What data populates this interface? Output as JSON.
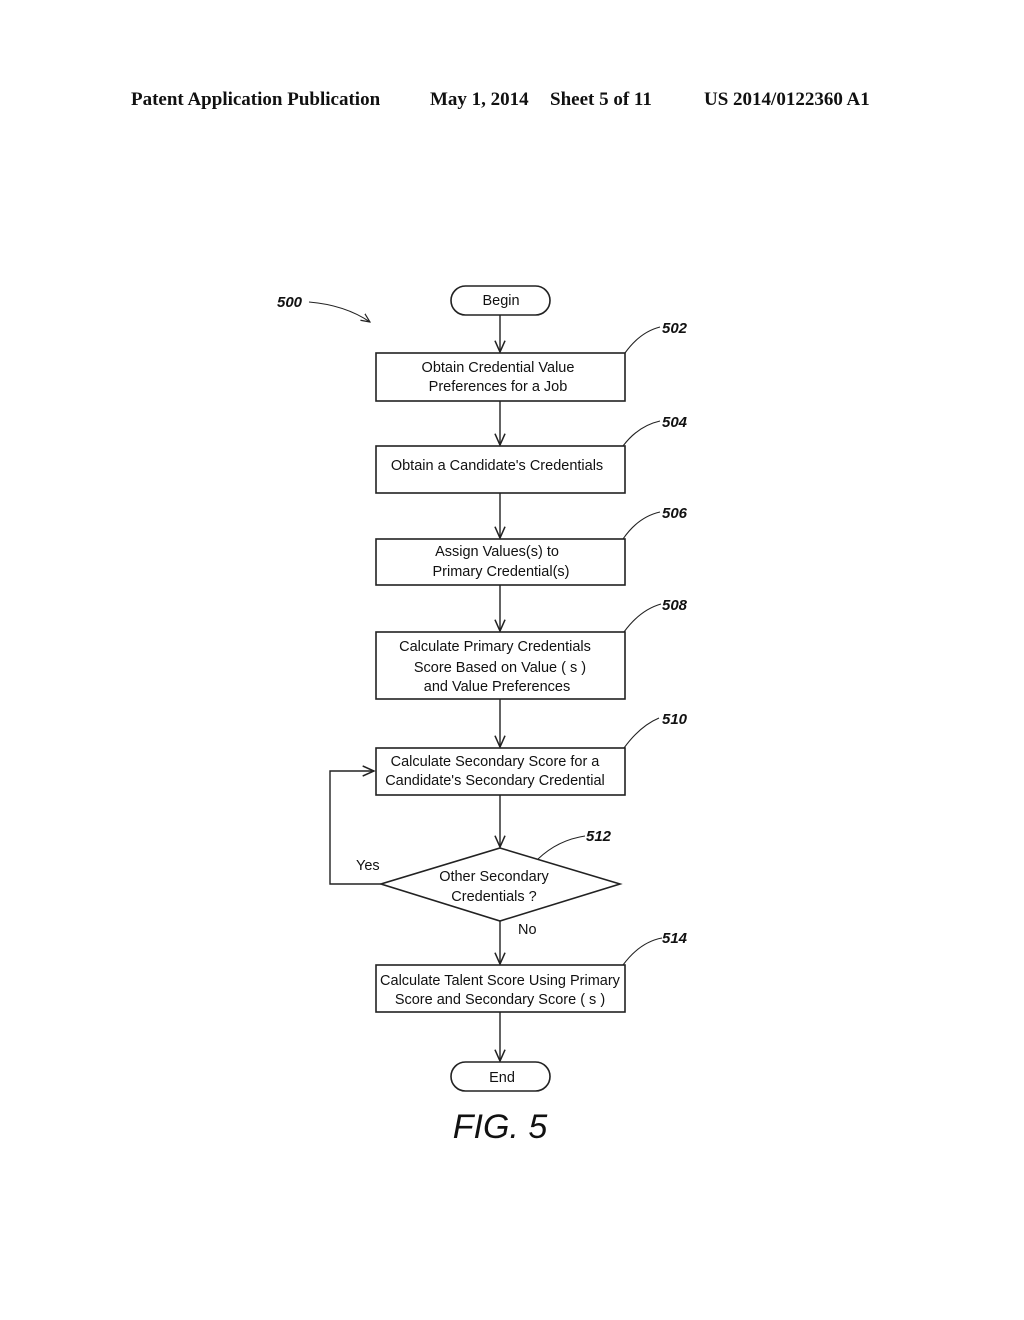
{
  "header": {
    "publication": "Patent Application Publication",
    "date": "May 1, 2014",
    "sheet": "Sheet 5 of 11",
    "number": "US 2014/0122360 A1"
  },
  "figure": {
    "label": "FIG. 5",
    "ref": "500"
  },
  "nodes": {
    "begin": {
      "type": "terminal",
      "lines": [
        "Begin"
      ]
    },
    "n502": {
      "type": "process",
      "ref": "502",
      "lines": [
        "Obtain Credential Value",
        "Preferences for a Job"
      ]
    },
    "n504": {
      "type": "process",
      "ref": "504",
      "lines": [
        "Obtain a Candidate's Credentials"
      ]
    },
    "n506": {
      "type": "process",
      "ref": "506",
      "lines": [
        "Assign Values(s)  to",
        "Primary Credential(s)"
      ]
    },
    "n508": {
      "type": "process",
      "ref": "508",
      "lines": [
        "Calculate Primary Credentials",
        "Score Based on Value ( s )",
        "and Value Preferences"
      ]
    },
    "n510": {
      "type": "process",
      "ref": "510",
      "lines": [
        "Calculate Secondary Score for a",
        "Candidate's Secondary Credential"
      ]
    },
    "n512": {
      "type": "decision",
      "ref": "512",
      "lines": [
        "Other Secondary",
        "Credentials ?"
      ]
    },
    "n514": {
      "type": "process",
      "ref": "514",
      "lines": [
        "Calculate Talent Score Using Primary",
        "Score and Secondary Score ( s )"
      ]
    },
    "end": {
      "type": "terminal",
      "lines": [
        "End"
      ]
    }
  },
  "edges": [
    {
      "from": "begin",
      "to": "n502",
      "label": ""
    },
    {
      "from": "n502",
      "to": "n504",
      "label": ""
    },
    {
      "from": "n504",
      "to": "n506",
      "label": ""
    },
    {
      "from": "n506",
      "to": "n508",
      "label": ""
    },
    {
      "from": "n508",
      "to": "n510",
      "label": ""
    },
    {
      "from": "n510",
      "to": "n512",
      "label": ""
    },
    {
      "from": "n512",
      "to": "n510",
      "label": "Yes"
    },
    {
      "from": "n512",
      "to": "n514",
      "label": "No"
    },
    {
      "from": "n514",
      "to": "end",
      "label": ""
    }
  ]
}
